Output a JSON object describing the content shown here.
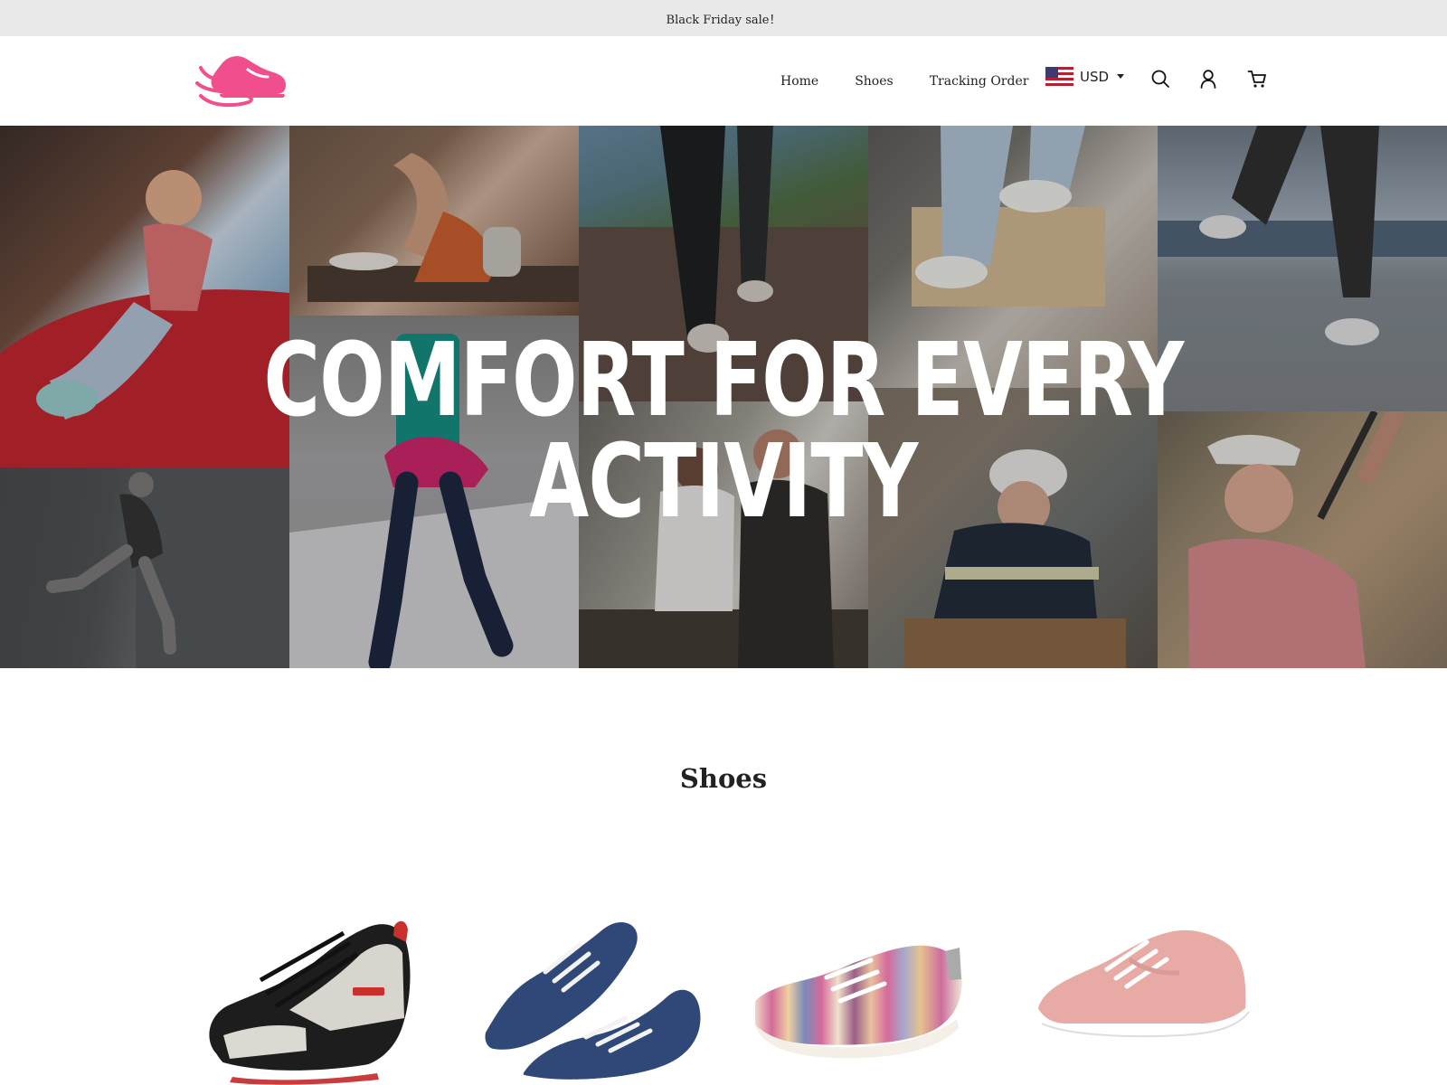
{
  "announcement": {
    "text": "Black Friday sale！"
  },
  "header": {
    "logo_icon": "pink-sneaker-logo-icon",
    "nav": [
      {
        "label": "Home"
      },
      {
        "label": "Shoes"
      },
      {
        "label": "Tracking Order"
      }
    ],
    "currency": {
      "value": "USD",
      "flag_icon": "us-flag-icon"
    },
    "icons": [
      "search-icon",
      "user-icon",
      "cart-icon"
    ]
  },
  "hero": {
    "headline": "COMFORT FOR EVERY ACTIVITY"
  },
  "collection": {
    "title": "Shoes",
    "products": [
      {
        "image": "black-white-sneaker",
        "colors": [
          "#1d1d1d",
          "#d8d4ce",
          "#c9302c"
        ]
      },
      {
        "image": "navy-canvas-sneakers",
        "colors": [
          "#2f4877",
          "#ffffff"
        ]
      },
      {
        "image": "striped-slip-on-sneaker",
        "colors": [
          "#d46a9a",
          "#e8c7a0",
          "#7a8bb8"
        ]
      },
      {
        "image": "pink-platform-sneaker",
        "colors": [
          "#e8aaa4",
          "#ffffff"
        ]
      }
    ]
  },
  "colors": {
    "brand_pink": "#f14e8d",
    "announcement_bg": "#e9e9e9",
    "text": "#222222"
  }
}
